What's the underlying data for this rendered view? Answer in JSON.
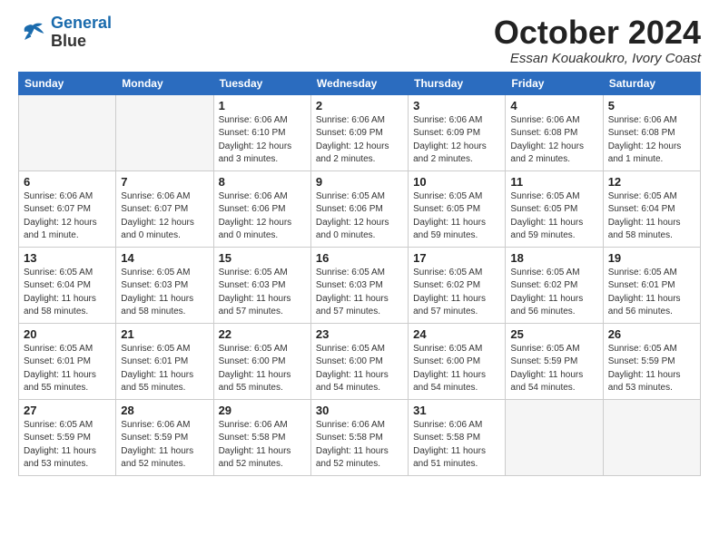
{
  "logo": {
    "line1": "General",
    "line2": "Blue"
  },
  "title": "October 2024",
  "subtitle": "Essan Kouakoukro, Ivory Coast",
  "days_header": [
    "Sunday",
    "Monday",
    "Tuesday",
    "Wednesday",
    "Thursday",
    "Friday",
    "Saturday"
  ],
  "weeks": [
    [
      {
        "day": "",
        "info": ""
      },
      {
        "day": "",
        "info": ""
      },
      {
        "day": "1",
        "info": "Sunrise: 6:06 AM\nSunset: 6:10 PM\nDaylight: 12 hours\nand 3 minutes."
      },
      {
        "day": "2",
        "info": "Sunrise: 6:06 AM\nSunset: 6:09 PM\nDaylight: 12 hours\nand 2 minutes."
      },
      {
        "day": "3",
        "info": "Sunrise: 6:06 AM\nSunset: 6:09 PM\nDaylight: 12 hours\nand 2 minutes."
      },
      {
        "day": "4",
        "info": "Sunrise: 6:06 AM\nSunset: 6:08 PM\nDaylight: 12 hours\nand 2 minutes."
      },
      {
        "day": "5",
        "info": "Sunrise: 6:06 AM\nSunset: 6:08 PM\nDaylight: 12 hours\nand 1 minute."
      }
    ],
    [
      {
        "day": "6",
        "info": "Sunrise: 6:06 AM\nSunset: 6:07 PM\nDaylight: 12 hours\nand 1 minute."
      },
      {
        "day": "7",
        "info": "Sunrise: 6:06 AM\nSunset: 6:07 PM\nDaylight: 12 hours\nand 0 minutes."
      },
      {
        "day": "8",
        "info": "Sunrise: 6:06 AM\nSunset: 6:06 PM\nDaylight: 12 hours\nand 0 minutes."
      },
      {
        "day": "9",
        "info": "Sunrise: 6:05 AM\nSunset: 6:06 PM\nDaylight: 12 hours\nand 0 minutes."
      },
      {
        "day": "10",
        "info": "Sunrise: 6:05 AM\nSunset: 6:05 PM\nDaylight: 11 hours\nand 59 minutes."
      },
      {
        "day": "11",
        "info": "Sunrise: 6:05 AM\nSunset: 6:05 PM\nDaylight: 11 hours\nand 59 minutes."
      },
      {
        "day": "12",
        "info": "Sunrise: 6:05 AM\nSunset: 6:04 PM\nDaylight: 11 hours\nand 58 minutes."
      }
    ],
    [
      {
        "day": "13",
        "info": "Sunrise: 6:05 AM\nSunset: 6:04 PM\nDaylight: 11 hours\nand 58 minutes."
      },
      {
        "day": "14",
        "info": "Sunrise: 6:05 AM\nSunset: 6:03 PM\nDaylight: 11 hours\nand 58 minutes."
      },
      {
        "day": "15",
        "info": "Sunrise: 6:05 AM\nSunset: 6:03 PM\nDaylight: 11 hours\nand 57 minutes."
      },
      {
        "day": "16",
        "info": "Sunrise: 6:05 AM\nSunset: 6:03 PM\nDaylight: 11 hours\nand 57 minutes."
      },
      {
        "day": "17",
        "info": "Sunrise: 6:05 AM\nSunset: 6:02 PM\nDaylight: 11 hours\nand 57 minutes."
      },
      {
        "day": "18",
        "info": "Sunrise: 6:05 AM\nSunset: 6:02 PM\nDaylight: 11 hours\nand 56 minutes."
      },
      {
        "day": "19",
        "info": "Sunrise: 6:05 AM\nSunset: 6:01 PM\nDaylight: 11 hours\nand 56 minutes."
      }
    ],
    [
      {
        "day": "20",
        "info": "Sunrise: 6:05 AM\nSunset: 6:01 PM\nDaylight: 11 hours\nand 55 minutes."
      },
      {
        "day": "21",
        "info": "Sunrise: 6:05 AM\nSunset: 6:01 PM\nDaylight: 11 hours\nand 55 minutes."
      },
      {
        "day": "22",
        "info": "Sunrise: 6:05 AM\nSunset: 6:00 PM\nDaylight: 11 hours\nand 55 minutes."
      },
      {
        "day": "23",
        "info": "Sunrise: 6:05 AM\nSunset: 6:00 PM\nDaylight: 11 hours\nand 54 minutes."
      },
      {
        "day": "24",
        "info": "Sunrise: 6:05 AM\nSunset: 6:00 PM\nDaylight: 11 hours\nand 54 minutes."
      },
      {
        "day": "25",
        "info": "Sunrise: 6:05 AM\nSunset: 5:59 PM\nDaylight: 11 hours\nand 54 minutes."
      },
      {
        "day": "26",
        "info": "Sunrise: 6:05 AM\nSunset: 5:59 PM\nDaylight: 11 hours\nand 53 minutes."
      }
    ],
    [
      {
        "day": "27",
        "info": "Sunrise: 6:05 AM\nSunset: 5:59 PM\nDaylight: 11 hours\nand 53 minutes."
      },
      {
        "day": "28",
        "info": "Sunrise: 6:06 AM\nSunset: 5:59 PM\nDaylight: 11 hours\nand 52 minutes."
      },
      {
        "day": "29",
        "info": "Sunrise: 6:06 AM\nSunset: 5:58 PM\nDaylight: 11 hours\nand 52 minutes."
      },
      {
        "day": "30",
        "info": "Sunrise: 6:06 AM\nSunset: 5:58 PM\nDaylight: 11 hours\nand 52 minutes."
      },
      {
        "day": "31",
        "info": "Sunrise: 6:06 AM\nSunset: 5:58 PM\nDaylight: 11 hours\nand 51 minutes."
      },
      {
        "day": "",
        "info": ""
      },
      {
        "day": "",
        "info": ""
      }
    ]
  ]
}
